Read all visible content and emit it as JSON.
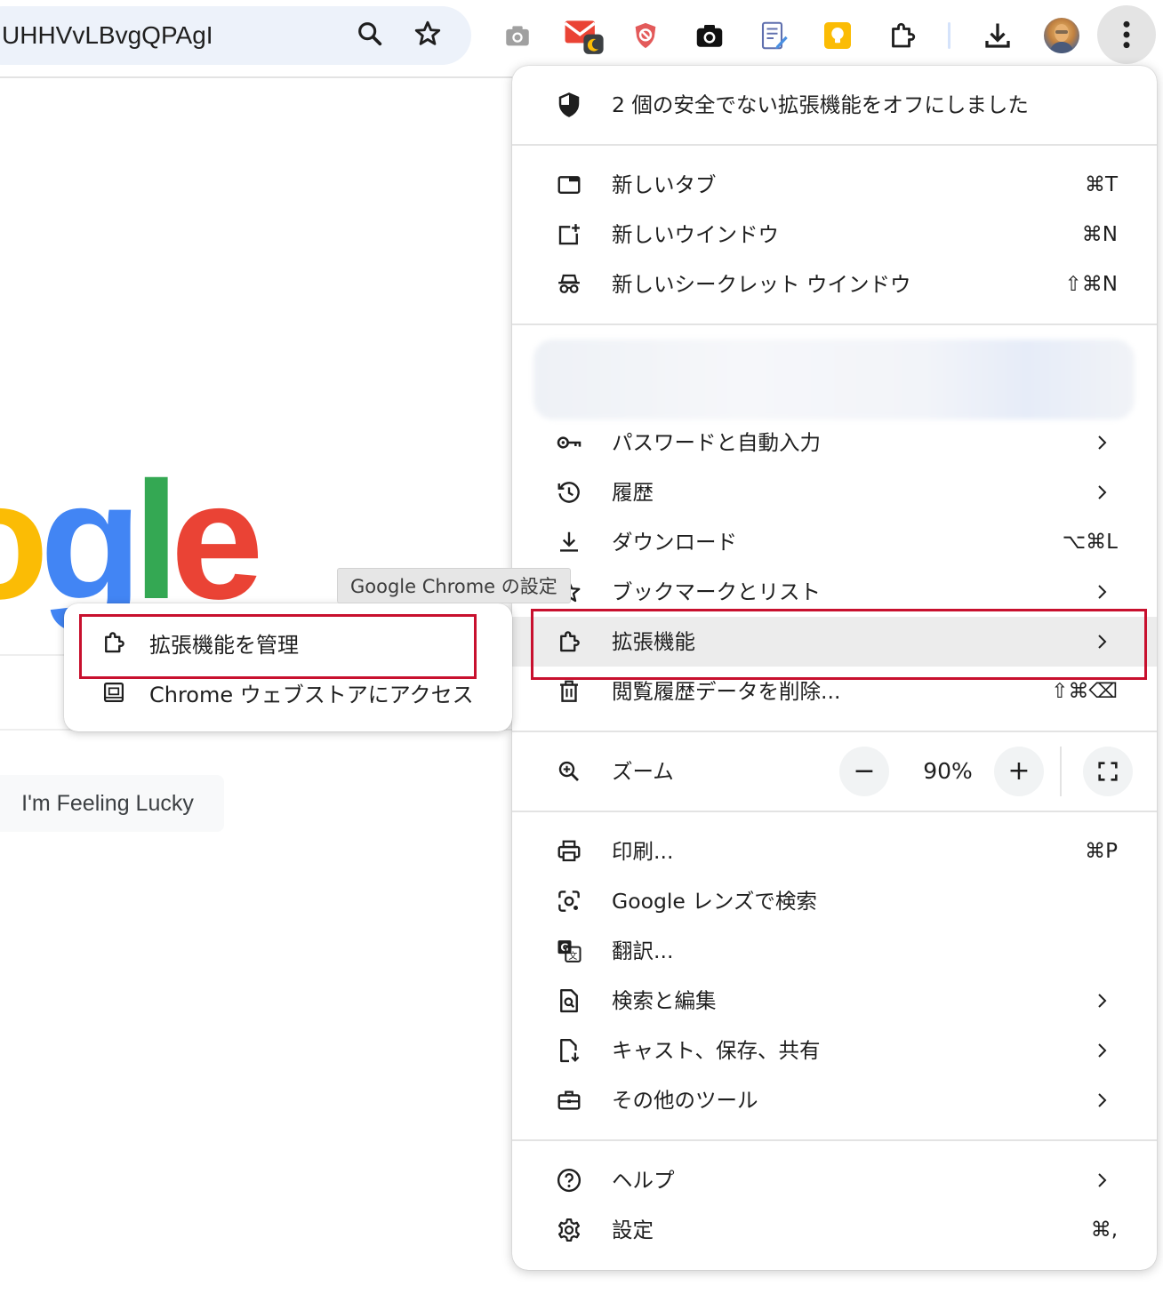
{
  "toolbar": {
    "omnibox_text": "UHHVvLBvgQPAgI",
    "icons": [
      "search-icon",
      "star-icon",
      "camera-extension-icon",
      "gmail-extension-icon",
      "shield-extension-icon",
      "screenshot-extension-icon",
      "notes-extension-icon",
      "bulb-extension-icon",
      "extensions-puzzle-icon",
      "download-icon",
      "avatar",
      "kebab-menu-icon"
    ]
  },
  "page": {
    "logo_letters": [
      "o",
      "g",
      "l",
      "e"
    ],
    "lucky_button": "I'm Feeling Lucky"
  },
  "tooltip": "Google Chrome の設定",
  "submenu": {
    "items": [
      {
        "label": "拡張機能を管理",
        "icon": "puzzle-icon"
      },
      {
        "label": "Chrome ウェブストアにアクセス",
        "icon": "webstore-icon"
      }
    ]
  },
  "menu": {
    "warning": "2 個の安全でない拡張機能をオフにしました",
    "new_tab": {
      "label": "新しいタブ",
      "shortcut": "⌘T"
    },
    "new_window": {
      "label": "新しいウインドウ",
      "shortcut": "⌘N"
    },
    "incognito": {
      "label": "新しいシークレット ウインドウ",
      "shortcut": "⇧⌘N"
    },
    "passwords": {
      "label": "パスワードと自動入力"
    },
    "history": {
      "label": "履歴"
    },
    "downloads": {
      "label": "ダウンロード",
      "shortcut": "⌥⌘L"
    },
    "bookmarks": {
      "label": "ブックマークとリスト"
    },
    "extensions": {
      "label": "拡張機能"
    },
    "clear_data": {
      "label": "閲覧履歴データを削除...",
      "shortcut": "⇧⌘⌫"
    },
    "zoom": {
      "label": "ズーム",
      "value": "90%",
      "minus": "−",
      "plus": "+"
    },
    "print": {
      "label": "印刷...",
      "shortcut": "⌘P"
    },
    "lens": {
      "label": "Google レンズで検索"
    },
    "translate": {
      "label": "翻訳..."
    },
    "find_edit": {
      "label": "検索と編集"
    },
    "cast": {
      "label": "キャスト、保存、共有"
    },
    "more_tools": {
      "label": "その他のツール"
    },
    "help": {
      "label": "ヘルプ"
    },
    "settings": {
      "label": "設定",
      "shortcut": "⌘,"
    }
  },
  "colors": {
    "highlight_border": "#c8102e",
    "google_blue": "#4285f4",
    "google_red": "#ea4335",
    "google_yellow": "#fbbc05",
    "google_green": "#34a853"
  }
}
